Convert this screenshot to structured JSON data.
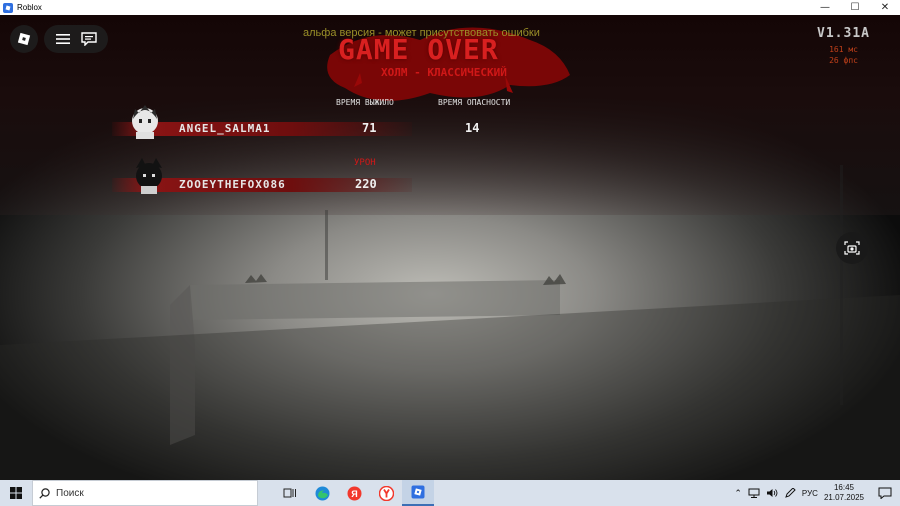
{
  "window": {
    "title": "Roblox",
    "minimize": "—",
    "maximize": "☐",
    "close": "✕"
  },
  "hud": {
    "alpha_note": "альфа версия - может присутствовать ошибки",
    "game_over": "GAME OVER",
    "map_name": "ХОЛМ - КЛАССИЧЕСКИЙ",
    "version": "V1.31A",
    "ping": "161 мс",
    "fps": "26 фпс"
  },
  "scoreboard": {
    "col_survived": "ВРЕМЯ ВЫЖИЛО",
    "col_danger": "ВРЕМЯ ОПАСНОСТИ",
    "damage_label": "УРОН",
    "players": [
      {
        "name": "ANGEL_SALMA1",
        "survived": "71",
        "danger": "14"
      },
      {
        "name": "ZOOEYTHEFOX086",
        "damage": "220"
      }
    ]
  },
  "taskbar": {
    "search_placeholder": "Поиск",
    "language": "РУС",
    "time": "16:45",
    "date": "21.07.2025"
  },
  "colors": {
    "accent_red": "#d82020",
    "alpha_text": "#9a8f28",
    "taskbar_bg": "#d9e1ec"
  }
}
